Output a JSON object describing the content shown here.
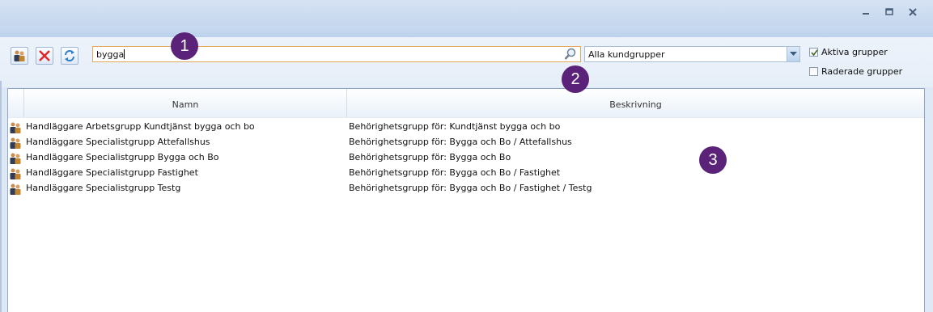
{
  "window": {
    "buttons": [
      "minimize",
      "restore",
      "close"
    ]
  },
  "toolbar": {
    "buttons": [
      {
        "icon": "user-group-icon"
      },
      {
        "icon": "delete-icon"
      },
      {
        "icon": "refresh-icon"
      }
    ],
    "search_value": "bygga",
    "customer_group_select": "Alla kundgrupper",
    "active_groups_label": "Aktiva grupper",
    "active_groups_checked": true,
    "deleted_groups_label": "Raderade grupper",
    "deleted_groups_checked": false
  },
  "markers": [
    "1",
    "2",
    "3"
  ],
  "grid": {
    "columns": [
      "Namn",
      "Beskrivning"
    ],
    "rows": [
      {
        "name": "Handläggare Arbetsgrupp Kundtjänst bygga och bo",
        "description": "Behörighetsgrupp för: Kundtjänst bygga och bo"
      },
      {
        "name": "Handläggare Specialistgrupp Attefallshus",
        "description": "Behörighetsgrupp för: Bygga och Bo / Attefallshus"
      },
      {
        "name": "Handläggare Specialistgrupp Bygga och Bo",
        "description": "Behörighetsgrupp för: Bygga och Bo"
      },
      {
        "name": "Handläggare Specialistgrupp Fastighet",
        "description": "Behörighetsgrupp för: Bygga och Bo / Fastighet"
      },
      {
        "name": "Handläggare Specialistgrupp Testg",
        "description": "Behörighetsgrupp för: Bygga och Bo / Fastighet / Testg"
      }
    ]
  },
  "colors": {
    "marker": "#5a2279",
    "search_border": "#e3a95b",
    "grid_border": "#8fa7c6"
  }
}
